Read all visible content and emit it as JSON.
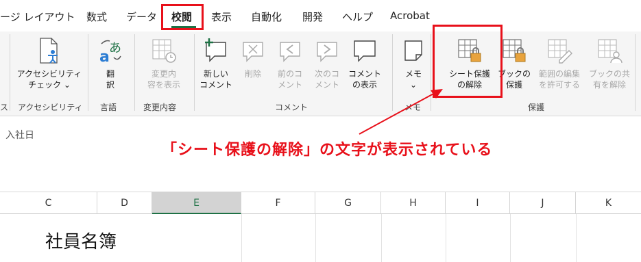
{
  "tabs": [
    "ージ レイアウト",
    "数式",
    "データ",
    "校閲",
    "表示",
    "自動化",
    "開発",
    "ヘルプ",
    "Acrobat"
  ],
  "active_tab": "校閲",
  "ribbon": {
    "partial_left_label": "ス",
    "accessibility": {
      "label": "アクセシビリティ\nチェック ⌄",
      "group": "アクセシビリティ"
    },
    "language": {
      "translate": "翻\n訳",
      "group": "言語"
    },
    "changes": {
      "label": "変更内\n容を表示",
      "group": "変更内容"
    },
    "comments": {
      "new": "新しい\nコメント",
      "delete": "削除",
      "prev": "前のコ\nメント",
      "next": "次のコ\nメント",
      "show": "コメント\nの表示",
      "group": "コメント"
    },
    "notes": {
      "label": "メモ\n⌄",
      "group": "メモ"
    },
    "protect": {
      "unprotect_sheet": "シート保護\nの解除",
      "protect_book": "ブックの\n保護",
      "allow_edit": "範囲の編集\nを許可する",
      "unshare": "ブックの共\n有を解除",
      "group": "保護"
    }
  },
  "formula_bar": {
    "content": "入社日"
  },
  "annotation": "「シート保護の解除」の文字が表示されている",
  "columns": [
    "C",
    "D",
    "E",
    "F",
    "G",
    "H",
    "I",
    "J",
    "K"
  ],
  "selected_column": "E",
  "sheet": {
    "title": "社員名簿"
  },
  "colors": {
    "accent": "#1e7145",
    "annotation_red": "#e8101a"
  }
}
